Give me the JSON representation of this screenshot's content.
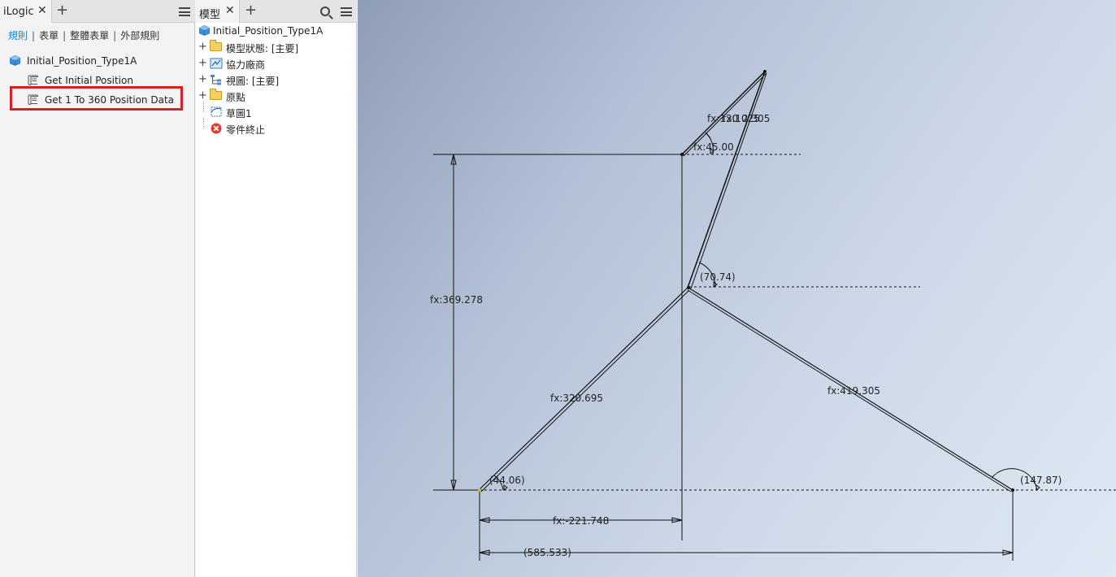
{
  "ilogic": {
    "tab_label": "iLogic",
    "subtabs": [
      "規則",
      "表單",
      "整體表單",
      "外部規則"
    ],
    "tree": {
      "root": "Initial_Position_Type1A",
      "rules": [
        "Get Initial Position",
        "Get 1 To 360 Position Data"
      ]
    }
  },
  "model": {
    "tab_label": "模型",
    "root": "Initial_Position_Type1A",
    "items": [
      {
        "label": "模型狀態: [主要]",
        "icon": "folder-icon"
      },
      {
        "label": "協力廠商",
        "icon": "third-party-icon"
      },
      {
        "label": "視圖: [主要]",
        "icon": "view-icon"
      },
      {
        "label": "原點",
        "icon": "folder-icon"
      },
      {
        "label": "草圖1",
        "icon": "sketch-icon"
      },
      {
        "label": "零件終止",
        "icon": "end-of-part-icon"
      }
    ]
  },
  "sketch": {
    "dims": {
      "top_link": "fx:130",
      "top_overlap": "fx:1025",
      "top_overlap2": "2.305",
      "angle_top": "fx:45.00",
      "angle_mid": "(70.74)",
      "height": "fx:369.278",
      "left_link": "fx:320.695",
      "right_link": "fx:419.305",
      "angle_left": "(44.06)",
      "angle_right": "(147.87)",
      "horiz_offset": "fx:-221.748",
      "total_width": "(585.533)"
    }
  },
  "colors": {
    "highlight": "#d42026",
    "active_subtab": "#1a7fc4",
    "part_blue": "#3d8fd9"
  }
}
